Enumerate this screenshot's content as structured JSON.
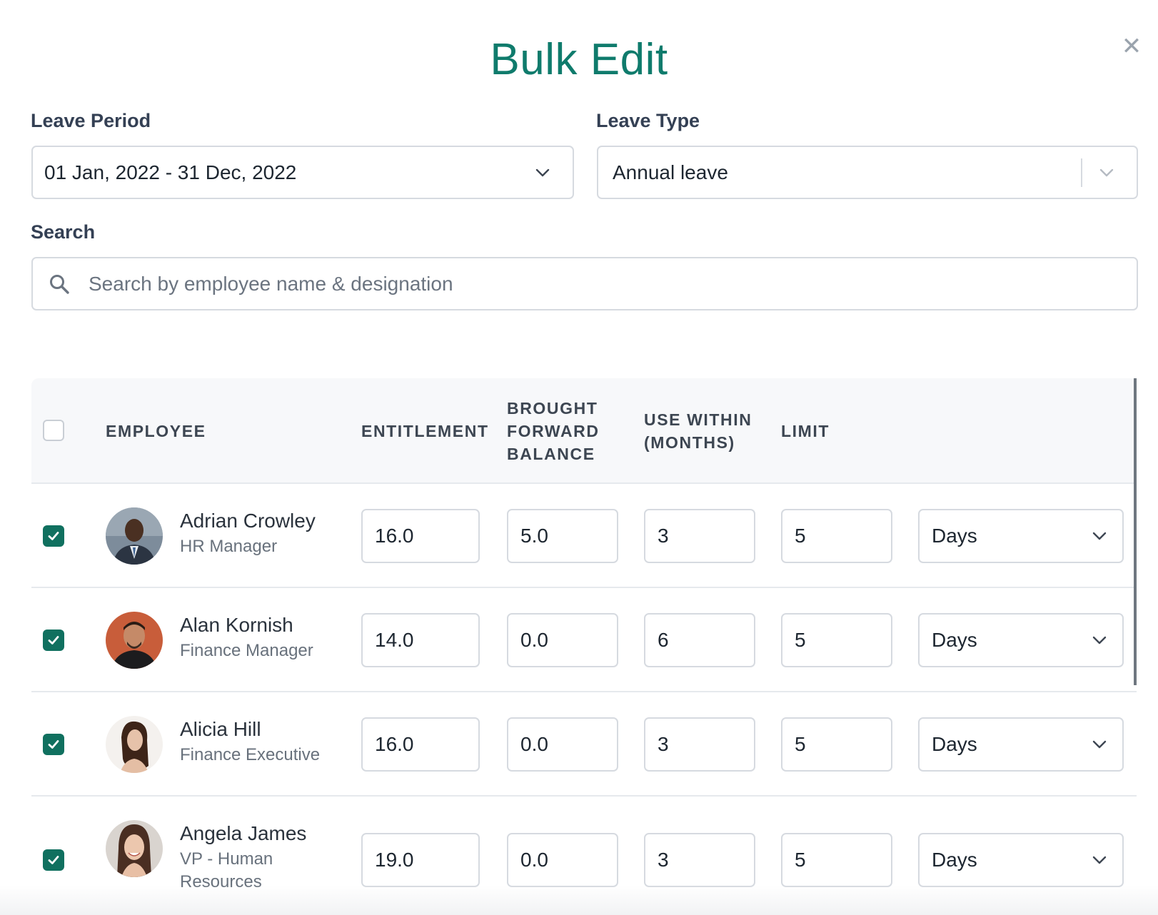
{
  "modal": {
    "title": "Bulk Edit",
    "close_icon": "close-icon"
  },
  "filters": {
    "leave_period": {
      "label": "Leave Period",
      "value": "01 Jan, 2022 - 31 Dec, 2022"
    },
    "leave_type": {
      "label": "Leave Type",
      "value": "Annual leave"
    },
    "search": {
      "label": "Search",
      "placeholder": "Search by employee name & designation",
      "value": ""
    }
  },
  "table": {
    "columns": {
      "employee": "EMPLOYEE",
      "entitlement": "ENTITLEMENT",
      "brought_forward": [
        "BROUGHT",
        "FORWARD",
        "BALANCE"
      ],
      "use_within": [
        "USE WITHIN",
        "(MONTHS)"
      ],
      "limit": "LIMIT"
    },
    "select_all_checked": false,
    "rows": [
      {
        "name": "Adrian Crowley",
        "role": "HR Manager",
        "checked": true,
        "entitlement": "16.0",
        "brought_forward": "5.0",
        "use_within": "3",
        "limit": "5",
        "unit": "Days"
      },
      {
        "name": "Alan Kornish",
        "role": "Finance Manager",
        "checked": true,
        "entitlement": "14.0",
        "brought_forward": "0.0",
        "use_within": "6",
        "limit": "5",
        "unit": "Days"
      },
      {
        "name": "Alicia Hill",
        "role": "Finance Executive",
        "checked": true,
        "entitlement": "16.0",
        "brought_forward": "0.0",
        "use_within": "3",
        "limit": "5",
        "unit": "Days"
      },
      {
        "name": "Angela James",
        "role": "VP - Human Resources",
        "checked": true,
        "entitlement": "19.0",
        "brought_forward": "0.0",
        "use_within": "3",
        "limit": "5",
        "unit": "Days"
      }
    ]
  },
  "colors": {
    "accent": "#0f7b6c",
    "checkbox_checked": "#10705f",
    "border": "#d6dae0",
    "header_bg": "#f7f8fa"
  }
}
